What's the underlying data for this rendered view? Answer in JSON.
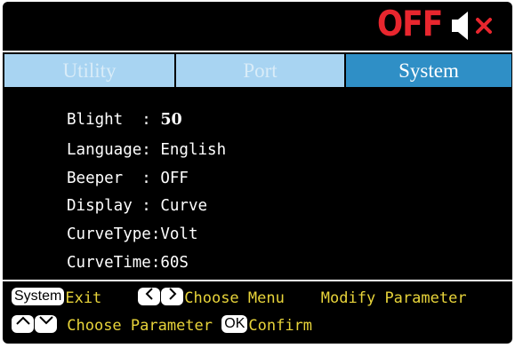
{
  "status": {
    "off_label": "OFF",
    "speaker_icon": "speaker-muted-icon",
    "accent_color": "#e8262e"
  },
  "tabs": [
    {
      "label": "Utility",
      "active": false
    },
    {
      "label": "Port",
      "active": false
    },
    {
      "label": "System",
      "active": true
    }
  ],
  "params": [
    {
      "label": "Blight  : ",
      "value": "50"
    },
    {
      "label": "Language: ",
      "value": "English"
    },
    {
      "label": "Beeper  : ",
      "value": "OFF"
    },
    {
      "label": "Display : ",
      "value": "Curve"
    },
    {
      "label": "CurveType:",
      "value": "Volt"
    },
    {
      "label": "CurveTime:",
      "value": "60S"
    }
  ],
  "help": {
    "system_key": "System",
    "exit": "Exit",
    "choose_menu": "Choose Menu",
    "modify_parameter": "Modify Parameter",
    "choose_parameter": "Choose Parameter",
    "ok_key": "OK",
    "confirm": "Confirm",
    "text_color": "#e8d43a"
  }
}
